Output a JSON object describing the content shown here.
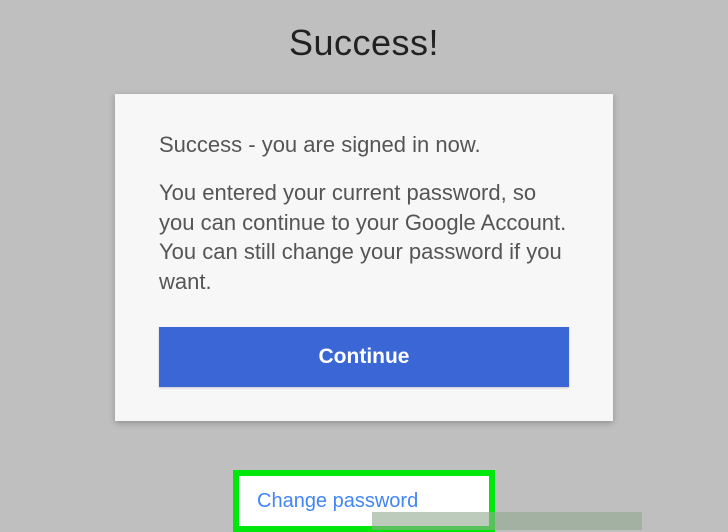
{
  "header": {
    "title": "Success!"
  },
  "card": {
    "heading": "Success - you are signed in now.",
    "body": "You entered your current password, so you can continue to your Google Account. You can still change your password if you want.",
    "continue_label": "Continue"
  },
  "footer": {
    "change_password_label": "Change password"
  }
}
